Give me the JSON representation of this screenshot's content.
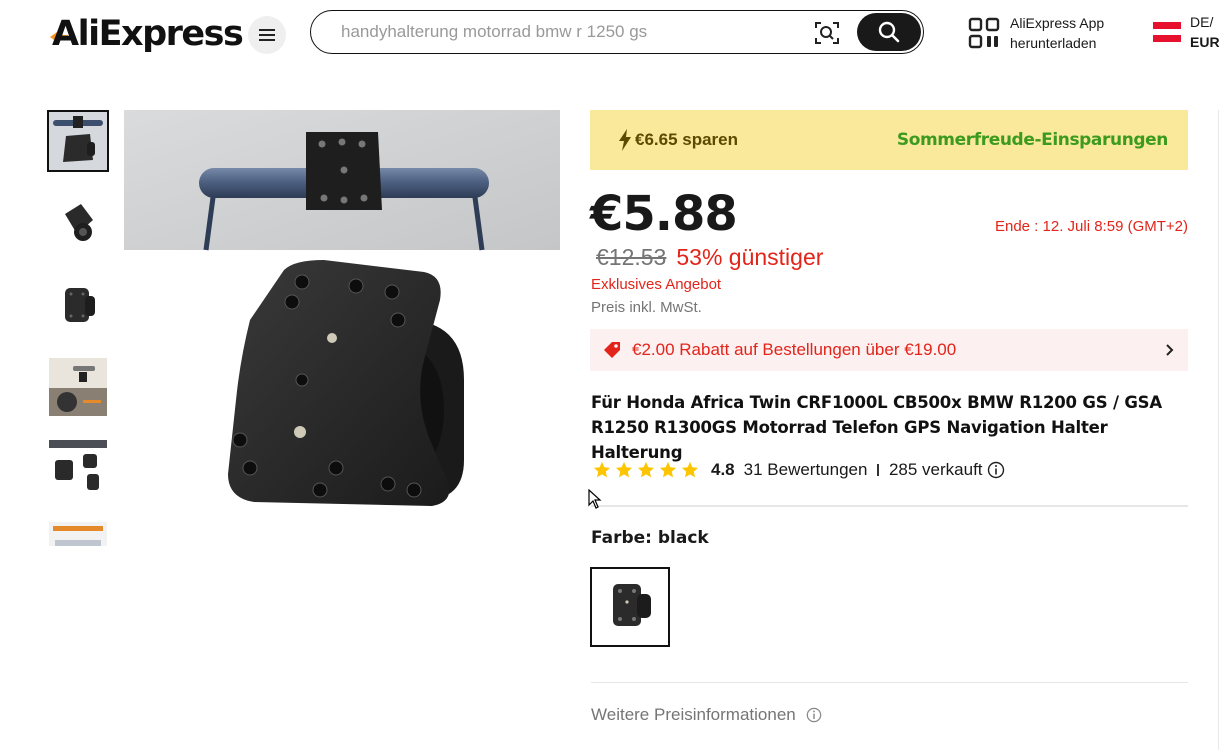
{
  "header": {
    "logo_text": "AliExpress",
    "search_placeholder": "handyhalterung motorrad bmw r 1250 gs",
    "app_line1": "AliExpress App",
    "app_line2": "herunterladen",
    "locale_lang": "DE/",
    "locale_currency": "EUR"
  },
  "gallery": {
    "thumbnail_count": 6,
    "active_index": 0
  },
  "savings_banner": {
    "amount": "€6.65 sparen",
    "campaign": "Sommerfreude-Einsparungen"
  },
  "pricing": {
    "price": "€5.88",
    "end_time": "Ende :  12. Juli 8:59 (GMT+2)",
    "original_price": "€12.53",
    "discount": "53% günstiger",
    "exclusive": "Exklusives Angebot",
    "tax_note": "Preis inkl. MwSt."
  },
  "coupon": {
    "text": "€2.00 Rabatt auf Bestellungen über €19.00"
  },
  "product": {
    "title": "Für Honda Africa Twin CRF1000L CB500x BMW R1200 GS / GSA R1250 R1300GS Motorrad Telefon GPS Navigation Halter Halterung"
  },
  "rating": {
    "stars": 5,
    "value": "4.8",
    "reviews": "31 Bewertungen",
    "sold": "285 verkauft"
  },
  "variant": {
    "color_label": "Farbe: black"
  },
  "more_price_info": "Weitere Preisinformationen",
  "colors": {
    "accent_red": "#e2241a",
    "savings_bg": "#fae99a",
    "savings_green": "#3c9a1e",
    "logo_orange": "#f7971e"
  }
}
